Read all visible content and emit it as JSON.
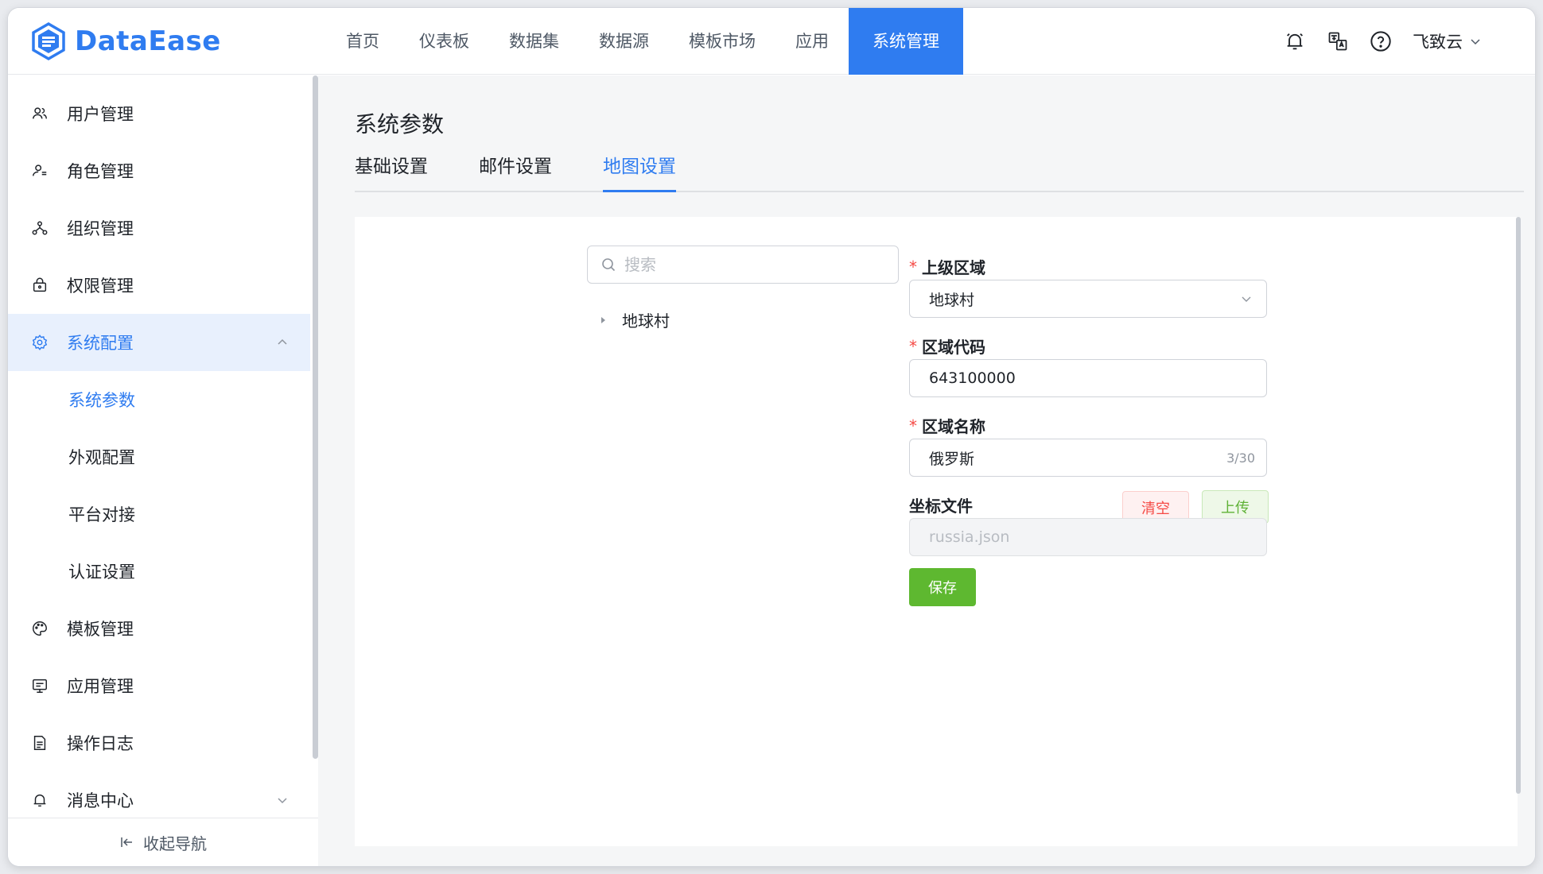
{
  "app": {
    "logo_text": "DataEase",
    "brand_color": "#2f7cf0"
  },
  "nav": {
    "items": [
      {
        "label": "首页"
      },
      {
        "label": "仪表板"
      },
      {
        "label": "数据集"
      },
      {
        "label": "数据源"
      },
      {
        "label": "模板市场"
      },
      {
        "label": "应用"
      },
      {
        "label": "系统管理",
        "active": true
      }
    ]
  },
  "header": {
    "icons": [
      "bell-icon",
      "translate-icon",
      "help-icon"
    ],
    "user_name": "飞致云"
  },
  "sidebar": {
    "items": [
      {
        "label": "用户管理",
        "icon": "users-icon"
      },
      {
        "label": "角色管理",
        "icon": "role-icon"
      },
      {
        "label": "组织管理",
        "icon": "org-icon"
      },
      {
        "label": "权限管理",
        "icon": "lock-icon"
      },
      {
        "label": "系统配置",
        "icon": "gear-icon",
        "expanded": true
      },
      {
        "label": "系统参数",
        "selected": true
      },
      {
        "label": "外观配置"
      },
      {
        "label": "平台对接"
      },
      {
        "label": "认证设置"
      },
      {
        "label": "模板管理",
        "icon": "palette-icon"
      },
      {
        "label": "应用管理",
        "icon": "app-icon"
      },
      {
        "label": "操作日志",
        "icon": "log-icon"
      },
      {
        "label": "消息中心",
        "icon": "bell-icon"
      }
    ],
    "collapse_label": "收起导航"
  },
  "page": {
    "title": "系统参数",
    "tabs": [
      {
        "label": "基础设置"
      },
      {
        "label": "邮件设置"
      },
      {
        "label": "地图设置",
        "active": true
      }
    ]
  },
  "map_settings": {
    "search_placeholder": "搜索",
    "tree": [
      {
        "label": "地球村"
      }
    ],
    "form": {
      "parent_area_label": "上级区域",
      "parent_area_value": "地球村",
      "area_code_label": "区域代码",
      "area_code_value": "643100000",
      "area_name_label": "区域名称",
      "area_name_value": "俄罗斯",
      "area_name_count": "3/30",
      "coord_file_label": "坐标文件",
      "coord_file_value": "russia.json",
      "clear_label": "清空",
      "upload_label": "上传",
      "save_label": "保存"
    }
  }
}
